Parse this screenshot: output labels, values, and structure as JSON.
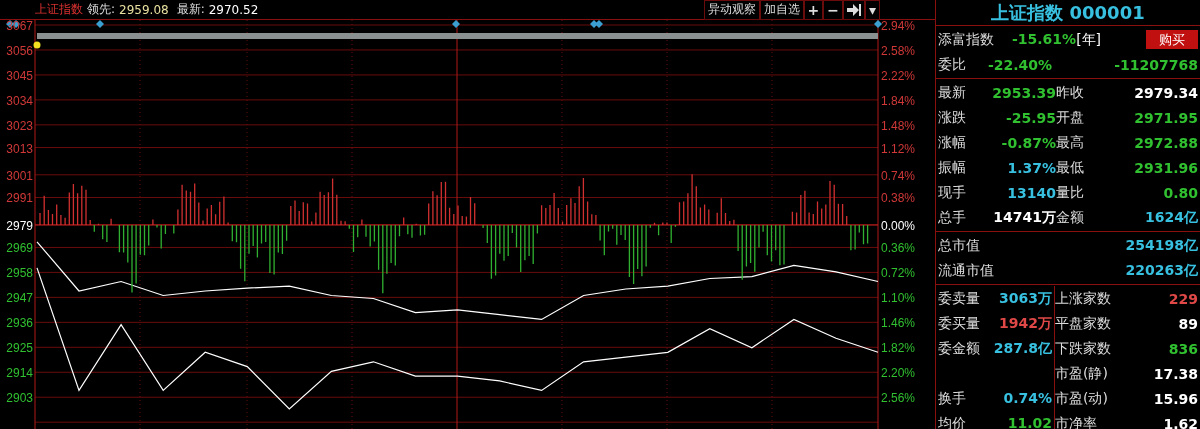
{
  "header": {
    "title": "上证指数",
    "lead_label": "领先:",
    "lead_value": "2959.08",
    "latest_label": "最新:",
    "latest_value": "2970.52"
  },
  "toolbar": [
    {
      "kind": "text",
      "label": "异动观察"
    },
    {
      "kind": "text",
      "label": "加自选"
    },
    {
      "kind": "glyph",
      "label": "+"
    },
    {
      "kind": "glyph",
      "label": "−"
    },
    {
      "kind": "icon"
    },
    {
      "kind": "glyph",
      "label": "▾"
    }
  ],
  "chart": {
    "right_axis": [
      {
        "label": "2.94%",
        "color": "#d03838"
      },
      {
        "label": "2.58%",
        "color": "#d03838"
      },
      {
        "label": "2.22%",
        "color": "#d03838"
      },
      {
        "label": "1.84%",
        "color": "#d03838"
      },
      {
        "label": "1.48%",
        "color": "#d03838"
      },
      {
        "label": "1.12%",
        "color": "#d03838"
      },
      {
        "label": "0.74%",
        "color": "#d03838"
      },
      {
        "label": "0.38%",
        "color": "#d03838"
      },
      {
        "label": "0.00%",
        "color": "#ffffff"
      },
      {
        "label": "0.36%",
        "color": "#30c030"
      },
      {
        "label": "0.72%",
        "color": "#30c030"
      },
      {
        "label": "1.10%",
        "color": "#30c030"
      },
      {
        "label": "1.46%",
        "color": "#30c030"
      },
      {
        "label": "1.82%",
        "color": "#30c030"
      },
      {
        "label": "2.20%",
        "color": "#30c030"
      },
      {
        "label": "2.56%",
        "color": "#30c030"
      }
    ],
    "chart_data": {
      "type": "line",
      "grid": true,
      "ylim": [
        2889,
        3067
      ],
      "yticks": [
        3067,
        3056,
        3045,
        3034,
        3023,
        3013,
        3001,
        2991,
        2979,
        2969,
        2958,
        2947,
        2936,
        2925,
        2914,
        2903
      ],
      "series": [
        {
          "color": "#ffffff",
          "values": [
            2971.5,
            2949.8,
            2954,
            2947.8,
            2949.8,
            2951.1,
            2951.9,
            2947.8,
            2946.5,
            2940.3,
            2941.5,
            2939.4,
            2937.3,
            2947.8,
            2950.7,
            2951.9,
            2955.3,
            2956.1,
            2961.1,
            2958.2,
            2954
          ]
        },
        {
          "color": "#ffffff",
          "values": [
            2960,
            2906,
            2935,
            2906,
            2922.8,
            2916.5,
            2897.8,
            2914.4,
            2918.6,
            2912.3,
            2912.3,
            2910.2,
            2906,
            2918.6,
            2920.7,
            2922.8,
            2933.2,
            2924.8,
            2937.3,
            2929,
            2922.8
          ]
        }
      ]
    }
  },
  "quote": {
    "title": "上证指数 000001",
    "index_row": {
      "label": "添富指数",
      "value": "-15.61%",
      "unit": "[年]",
      "button": "购买"
    },
    "ratio_row": {
      "label": "委比",
      "value": "-22.40%",
      "diff": "-11207768"
    },
    "rows": [
      {
        "left": {
          "label": "最新",
          "value": "2953.39",
          "color": "#30c030"
        },
        "right": {
          "label": "昨收",
          "value": "2979.34",
          "color": "#ffffff"
        }
      },
      {
        "left": {
          "label": "涨跌",
          "value": "-25.95",
          "color": "#30c030"
        },
        "right": {
          "label": "开盘",
          "value": "2971.95",
          "color": "#30c030"
        }
      },
      {
        "left": {
          "label": "涨幅",
          "value": "-0.87%",
          "color": "#30c030"
        },
        "right": {
          "label": "最高",
          "value": "2972.88",
          "color": "#30c030"
        }
      },
      {
        "left": {
          "label": "振幅",
          "value": "1.37%",
          "color": "#38c0e0"
        },
        "right": {
          "label": "最低",
          "value": "2931.96",
          "color": "#30c030"
        }
      },
      {
        "left": {
          "label": "现手",
          "value": "13140",
          "color": "#38c0e0"
        },
        "right": {
          "label": "量比",
          "value": "0.80",
          "color": "#30c030"
        }
      },
      {
        "left": {
          "label": "总手",
          "value": "14741万",
          "color": "#ffffff"
        },
        "right": {
          "label": "金额",
          "value": "1624亿",
          "color": "#38c0e0"
        }
      }
    ],
    "market": [
      {
        "label": "总市值",
        "value": "254198亿"
      },
      {
        "label": "流通市值",
        "value": "220263亿"
      }
    ],
    "rows2": [
      {
        "left": {
          "label": "委卖量",
          "value": "3063万",
          "color": "#38c0e0"
        },
        "right": {
          "label": "上涨家数",
          "value": "229",
          "color": "#e04848"
        }
      },
      {
        "left": {
          "label": "委买量",
          "value": "1942万",
          "color": "#e04848"
        },
        "right": {
          "label": "平盘家数",
          "value": "89",
          "color": "#ffffff"
        }
      },
      {
        "left": {
          "label": "委金额",
          "value": "287.8亿",
          "color": "#38c0e0"
        },
        "right": {
          "label": "下跌家数",
          "value": "836",
          "color": "#30c030"
        }
      },
      {
        "right": {
          "label": "市盈(静)",
          "value": "17.38",
          "color": "#ffffff"
        }
      },
      {
        "left": {
          "label": "换手",
          "value": "0.74%",
          "color": "#38c0e0"
        },
        "right": {
          "label": "市盈(动)",
          "value": "15.96",
          "color": "#ffffff"
        }
      },
      {
        "left": {
          "label": "均价",
          "value": "11.02",
          "color": "#30c030"
        },
        "right": {
          "label": "市净率",
          "value": "1.62",
          "color": "#ffffff"
        }
      }
    ]
  }
}
